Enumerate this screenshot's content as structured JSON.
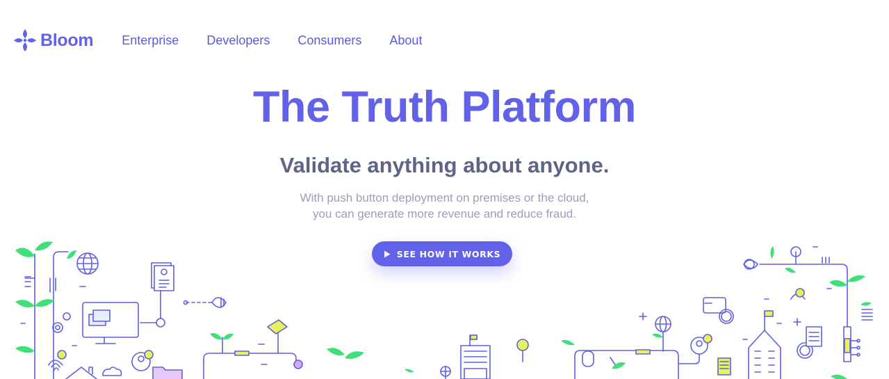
{
  "brand": {
    "name": "Bloom",
    "color": "#6262e8"
  },
  "nav": {
    "items": [
      {
        "label": "Enterprise"
      },
      {
        "label": "Developers"
      },
      {
        "label": "Consumers"
      },
      {
        "label": "About"
      }
    ]
  },
  "hero": {
    "title": "The Truth Platform",
    "subtitle": "Validate anything about anyone.",
    "description_line1": "With push button deployment on premises or the cloud,",
    "description_line2": "you can generate more revenue and reduce fraud.",
    "cta_label": "SEE HOW IT WORKS"
  },
  "colors": {
    "accent": "#6262e8",
    "leaf": "#3ee07a",
    "highlight": "#e8f25a",
    "text_muted": "#9a9eb8"
  },
  "icons": [
    "bloom-logo-icon",
    "play-icon",
    "globe-icon",
    "document-icon",
    "id-card-icon",
    "fingerprint-icon",
    "gear-icon",
    "house-icon",
    "building-icon",
    "coin-icon",
    "lightbulb-icon",
    "flag-icon",
    "monitor-icon",
    "user-check-icon"
  ]
}
